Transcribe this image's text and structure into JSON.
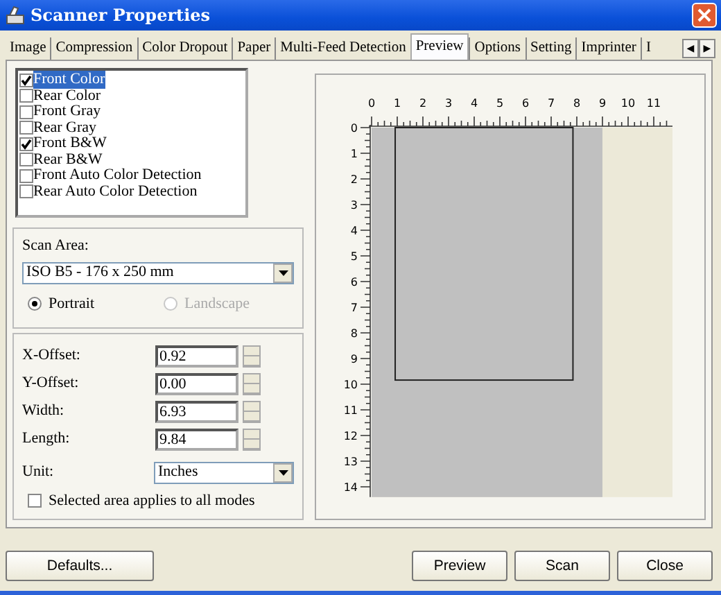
{
  "window": {
    "title": "Scanner Properties"
  },
  "tabs": [
    {
      "label": "Image",
      "selected": false
    },
    {
      "label": "Compression",
      "selected": false
    },
    {
      "label": "Color Dropout",
      "selected": false
    },
    {
      "label": "Paper",
      "selected": false
    },
    {
      "label": "Multi-Feed Detection",
      "selected": false
    },
    {
      "label": "Preview",
      "selected": true
    },
    {
      "label": "Options",
      "selected": false
    },
    {
      "label": "Setting",
      "selected": false
    },
    {
      "label": "Imprinter",
      "selected": false
    },
    {
      "label": "I",
      "selected": false
    }
  ],
  "tab_scroll": [
    "◀",
    "▶"
  ],
  "modes": [
    {
      "label": "Front Color",
      "checked": true,
      "selected": true
    },
    {
      "label": "Rear Color",
      "checked": false,
      "selected": false
    },
    {
      "label": "Front Gray",
      "checked": false,
      "selected": false
    },
    {
      "label": "Rear Gray",
      "checked": false,
      "selected": false
    },
    {
      "label": "Front B&W",
      "checked": true,
      "selected": false
    },
    {
      "label": "Rear B&W",
      "checked": false,
      "selected": false
    },
    {
      "label": "Front Auto Color Detection",
      "checked": false,
      "selected": false
    },
    {
      "label": "Rear Auto Color Detection",
      "checked": false,
      "selected": false
    }
  ],
  "scan_area": {
    "label": "Scan Area:",
    "value": "ISO B5 - 176 x 250 mm",
    "orientation": [
      {
        "label": "Portrait",
        "selected": true,
        "disabled": false
      },
      {
        "label": "Landscape",
        "selected": false,
        "disabled": true
      }
    ]
  },
  "fields": [
    {
      "label": "X-Offset:",
      "value": "0.92"
    },
    {
      "label": "Y-Offset:",
      "value": "0.00"
    },
    {
      "label": "Width:",
      "value": "6.93"
    },
    {
      "label": "Length:",
      "value": "9.84"
    }
  ],
  "unit": {
    "label": "Unit:",
    "value": "Inches"
  },
  "apply_all": {
    "label": "Selected area applies to all modes",
    "checked": false
  },
  "preview": {
    "x_ruler": [
      "0",
      "1",
      "2",
      "3",
      "4",
      "5",
      "6",
      "7",
      "8",
      "9",
      "10",
      "11"
    ],
    "y_ruler": [
      "0",
      "1",
      "2",
      "3",
      "4",
      "5",
      "6",
      "7",
      "8",
      "9",
      "10",
      "11",
      "12",
      "13",
      "14"
    ]
  },
  "buttons": {
    "left": [
      "Defaults..."
    ],
    "right": [
      "Preview",
      "Scan",
      "Close"
    ]
  }
}
